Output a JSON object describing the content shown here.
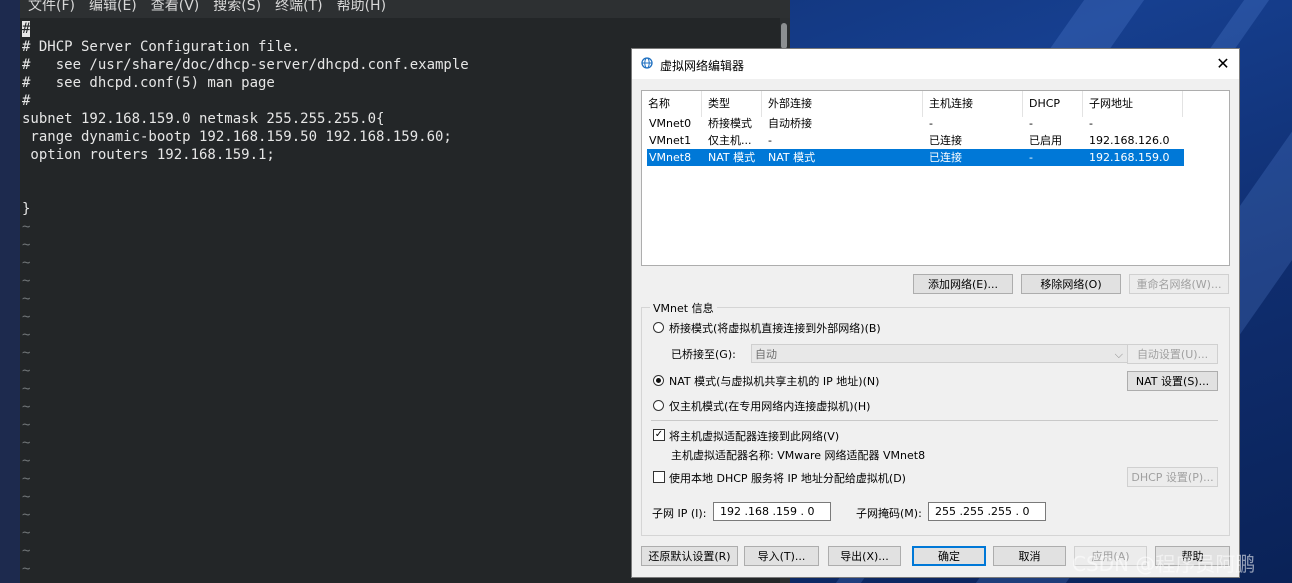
{
  "terminal": {
    "menu": [
      "文件(F)",
      "编辑(E)",
      "查看(V)",
      "搜索(S)",
      "终端(T)",
      "帮助(H)"
    ],
    "lines": [
      "#",
      "# DHCP Server Configuration file.",
      "#   see /usr/share/doc/dhcp-server/dhcpd.conf.example",
      "#   see dhcpd.conf(5) man page",
      "#",
      "subnet 192.168.159.0 netmask 255.255.255.0{",
      " range dynamic-bootp 192.168.159.50 192.168.159.60;",
      " option routers 192.168.159.1;",
      "",
      "",
      "}"
    ],
    "tilde_count": 20,
    "tilde_char": "~"
  },
  "dialog": {
    "title": "虚拟网络编辑器",
    "close": "✕",
    "table": {
      "headers": [
        "名称",
        "类型",
        "外部连接",
        "主机连接",
        "DHCP",
        "子网地址"
      ],
      "rows": [
        [
          "VMnet0",
          "桥接模式",
          "自动桥接",
          "-",
          "-",
          "-"
        ],
        [
          "VMnet1",
          "仅主机...",
          "-",
          "已连接",
          "已启用",
          "192.168.126.0"
        ],
        [
          "VMnet8",
          "NAT 模式",
          "NAT 模式",
          "已连接",
          "-",
          "192.168.159.0"
        ]
      ],
      "selected_row": 2
    },
    "buttons": {
      "add": "添加网络(E)...",
      "remove": "移除网络(O)",
      "rename": "重命名网络(W)..."
    },
    "info": {
      "legend": "VMnet 信息",
      "bridge_mode": "桥接模式(将虚拟机直接连接到外部网络)(B)",
      "bridged_to_label": "已桥接至(G):",
      "bridged_to_value": "自动",
      "auto_settings": "自动设置(U)...",
      "nat_mode": "NAT 模式(与虚拟机共享主机的 IP 地址)(N)",
      "nat_settings": "NAT 设置(S)...",
      "host_only": "仅主机模式(在专用网络内连接虚拟机)(H)",
      "connect_adapter": "将主机虚拟适配器连接到此网络(V)",
      "adapter_name": "主机虚拟适配器名称: VMware 网络适配器 VMnet8",
      "use_dhcp": "使用本地 DHCP 服务将 IP 地址分配给虚拟机(D)",
      "dhcp_settings": "DHCP 设置(P)...",
      "subnet_ip_label": "子网 IP (I):",
      "subnet_ip": "192 .168 .159 . 0",
      "subnet_mask_label": "子网掩码(M):",
      "subnet_mask": "255 .255 .255 . 0"
    },
    "footer": {
      "restore": "还原默认设置(R)",
      "import": "导入(T)...",
      "export": "导出(X)...",
      "ok": "确定",
      "cancel": "取消",
      "apply": "应用(A)",
      "help": "帮助"
    }
  },
  "watermark": "CSDN @程序员阿鹏",
  "colors": {
    "selection": "#0078d7",
    "terminal_bg": "#232628"
  }
}
